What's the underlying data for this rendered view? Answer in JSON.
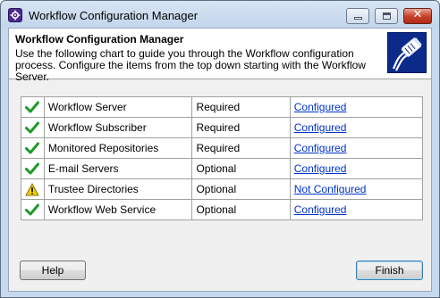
{
  "window": {
    "title": "Workflow Configuration Manager",
    "close_glyph": "✕"
  },
  "header": {
    "title": "Workflow Configuration Manager",
    "description": "Use the following chart to guide you through the Workflow configuration process. Configure the items from the top down starting with the Workflow Server.",
    "image_icon": "network-cable-icon"
  },
  "items": [
    {
      "name": "Workflow Server",
      "requirement": "Required",
      "status": "Configured",
      "icon": "check-icon"
    },
    {
      "name": "Workflow Subscriber",
      "requirement": "Required",
      "status": "Configured",
      "icon": "check-icon"
    },
    {
      "name": "Monitored Repositories",
      "requirement": "Required",
      "status": "Configured",
      "icon": "check-icon"
    },
    {
      "name": "E-mail Servers",
      "requirement": "Optional",
      "status": "Configured",
      "icon": "check-icon"
    },
    {
      "name": "Trustee Directories",
      "requirement": "Optional",
      "status": "Not Configured",
      "icon": "warning-icon"
    },
    {
      "name": "Workflow Web Service",
      "requirement": "Optional",
      "status": "Configured",
      "icon": "check-icon"
    }
  ],
  "buttons": {
    "help": "Help",
    "finish": "Finish"
  },
  "colors": {
    "link": "#0033cc",
    "check": "#1f9a2a",
    "warning": "#f2d200"
  }
}
